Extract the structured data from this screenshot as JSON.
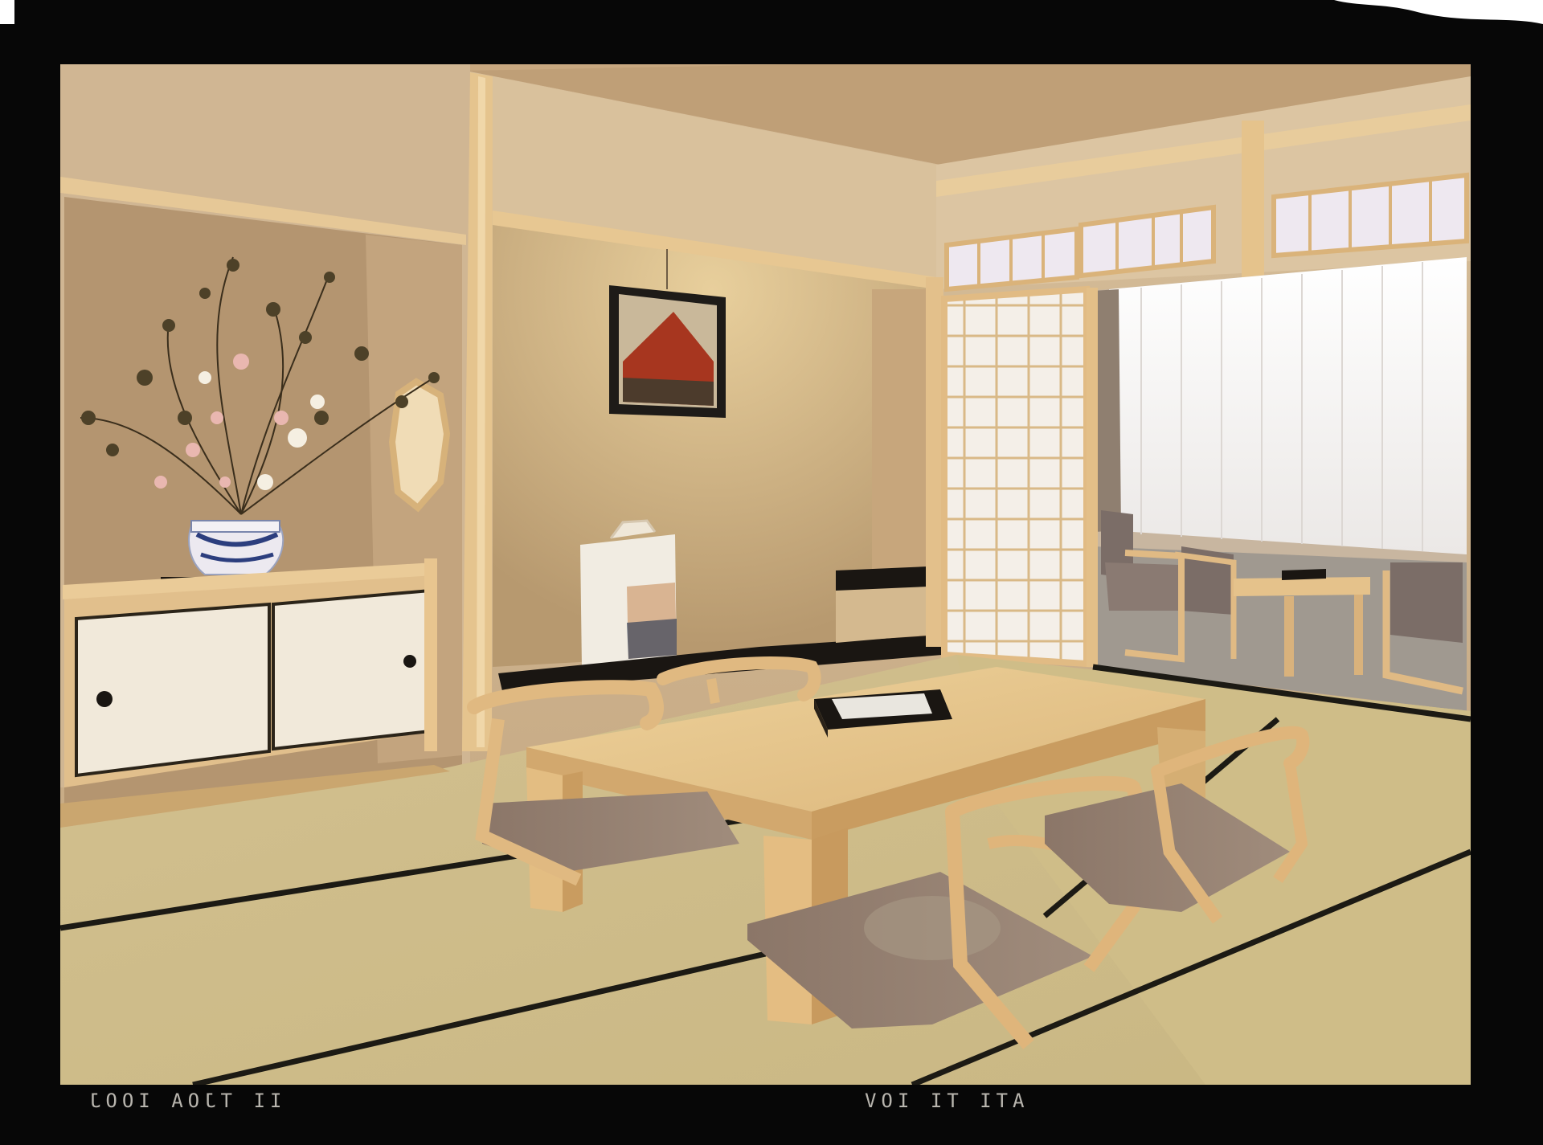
{
  "image": {
    "subject": "japanese-tatami-room",
    "film_edge_marks": {
      "left": "II TJOA IOOJ",
      "right": "ATI TI IOV"
    }
  },
  "colors": {
    "film_border": "#070707",
    "wall": "#cdb38f",
    "wall_shadow": "#b89a74",
    "ceiling": "#c2a27c",
    "wood": "#e2bb86",
    "wood_dark": "#c89860",
    "tatami": "#d6c69c",
    "tatami_border": "#1c1a14",
    "shoji_paper": "#f3eee6",
    "window_light": "#f6f4f2",
    "cushion": "#8f7a6c",
    "lacquer": "#1a1612"
  }
}
